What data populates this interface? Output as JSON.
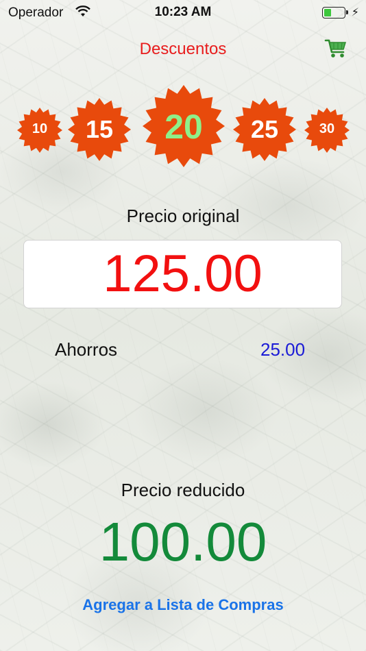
{
  "status": {
    "carrier": "Operador",
    "time": "10:23 AM"
  },
  "header": {
    "title": "Descuentos"
  },
  "discounts": [
    {
      "label": "10"
    },
    {
      "label": "15"
    },
    {
      "label": "20",
      "selected": true
    },
    {
      "label": "25"
    },
    {
      "label": "30"
    }
  ],
  "colors": {
    "badge": "#e84a0c",
    "selected_text": "#8ef08a",
    "title": "#e81d1d",
    "original_price": "#f21010",
    "savings": "#1b1bd6",
    "reduced_price": "#138a3a",
    "link": "#1a73e8"
  },
  "original": {
    "label": "Precio original",
    "value": "125.00"
  },
  "savings": {
    "label": "Ahorros",
    "value": "25.00"
  },
  "reduced": {
    "label": "Precio reducido",
    "value": "100.00"
  },
  "actions": {
    "add_to_list": "Agregar a Lista de Compras"
  },
  "icons": {
    "cart": "shopping-cart-icon",
    "wifi": "wifi-icon",
    "battery": "battery-icon"
  }
}
